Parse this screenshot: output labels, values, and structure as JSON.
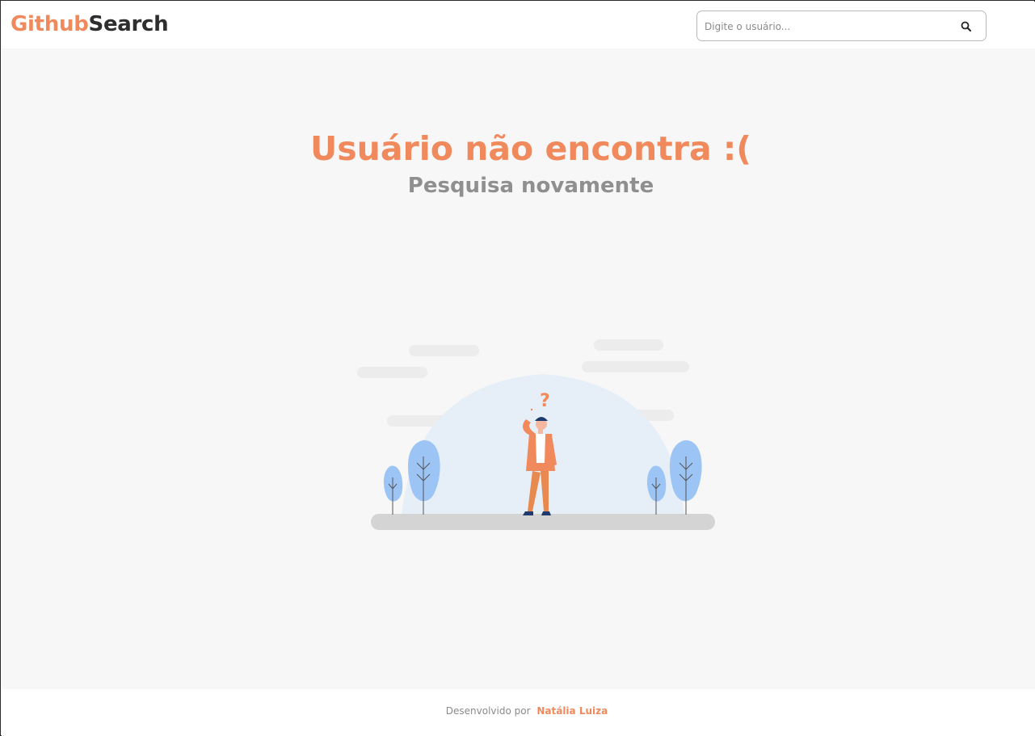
{
  "header": {
    "logo_part1": "Github",
    "logo_part2": "Search",
    "search": {
      "placeholder": "Digite o usuário...",
      "value": "",
      "icon": "search-icon"
    }
  },
  "main": {
    "title": "Usuário não encontra :(",
    "subtitle": "Pesquisa novamente",
    "illustration": {
      "question_mark": "?",
      "icons": [
        "cloud-icon",
        "tree-icon",
        "person-icon",
        "question-mark-icon"
      ]
    }
  },
  "footer": {
    "prefix": "Desenvolvido por",
    "author": "Natália Luiza"
  },
  "colors": {
    "accent": "#f08a5d",
    "dark": "#2e2e2e",
    "muted": "#8f8f8f",
    "background": "#f7f7f7",
    "tree": "#9cc5f5",
    "ground": "#d4d4d4"
  }
}
